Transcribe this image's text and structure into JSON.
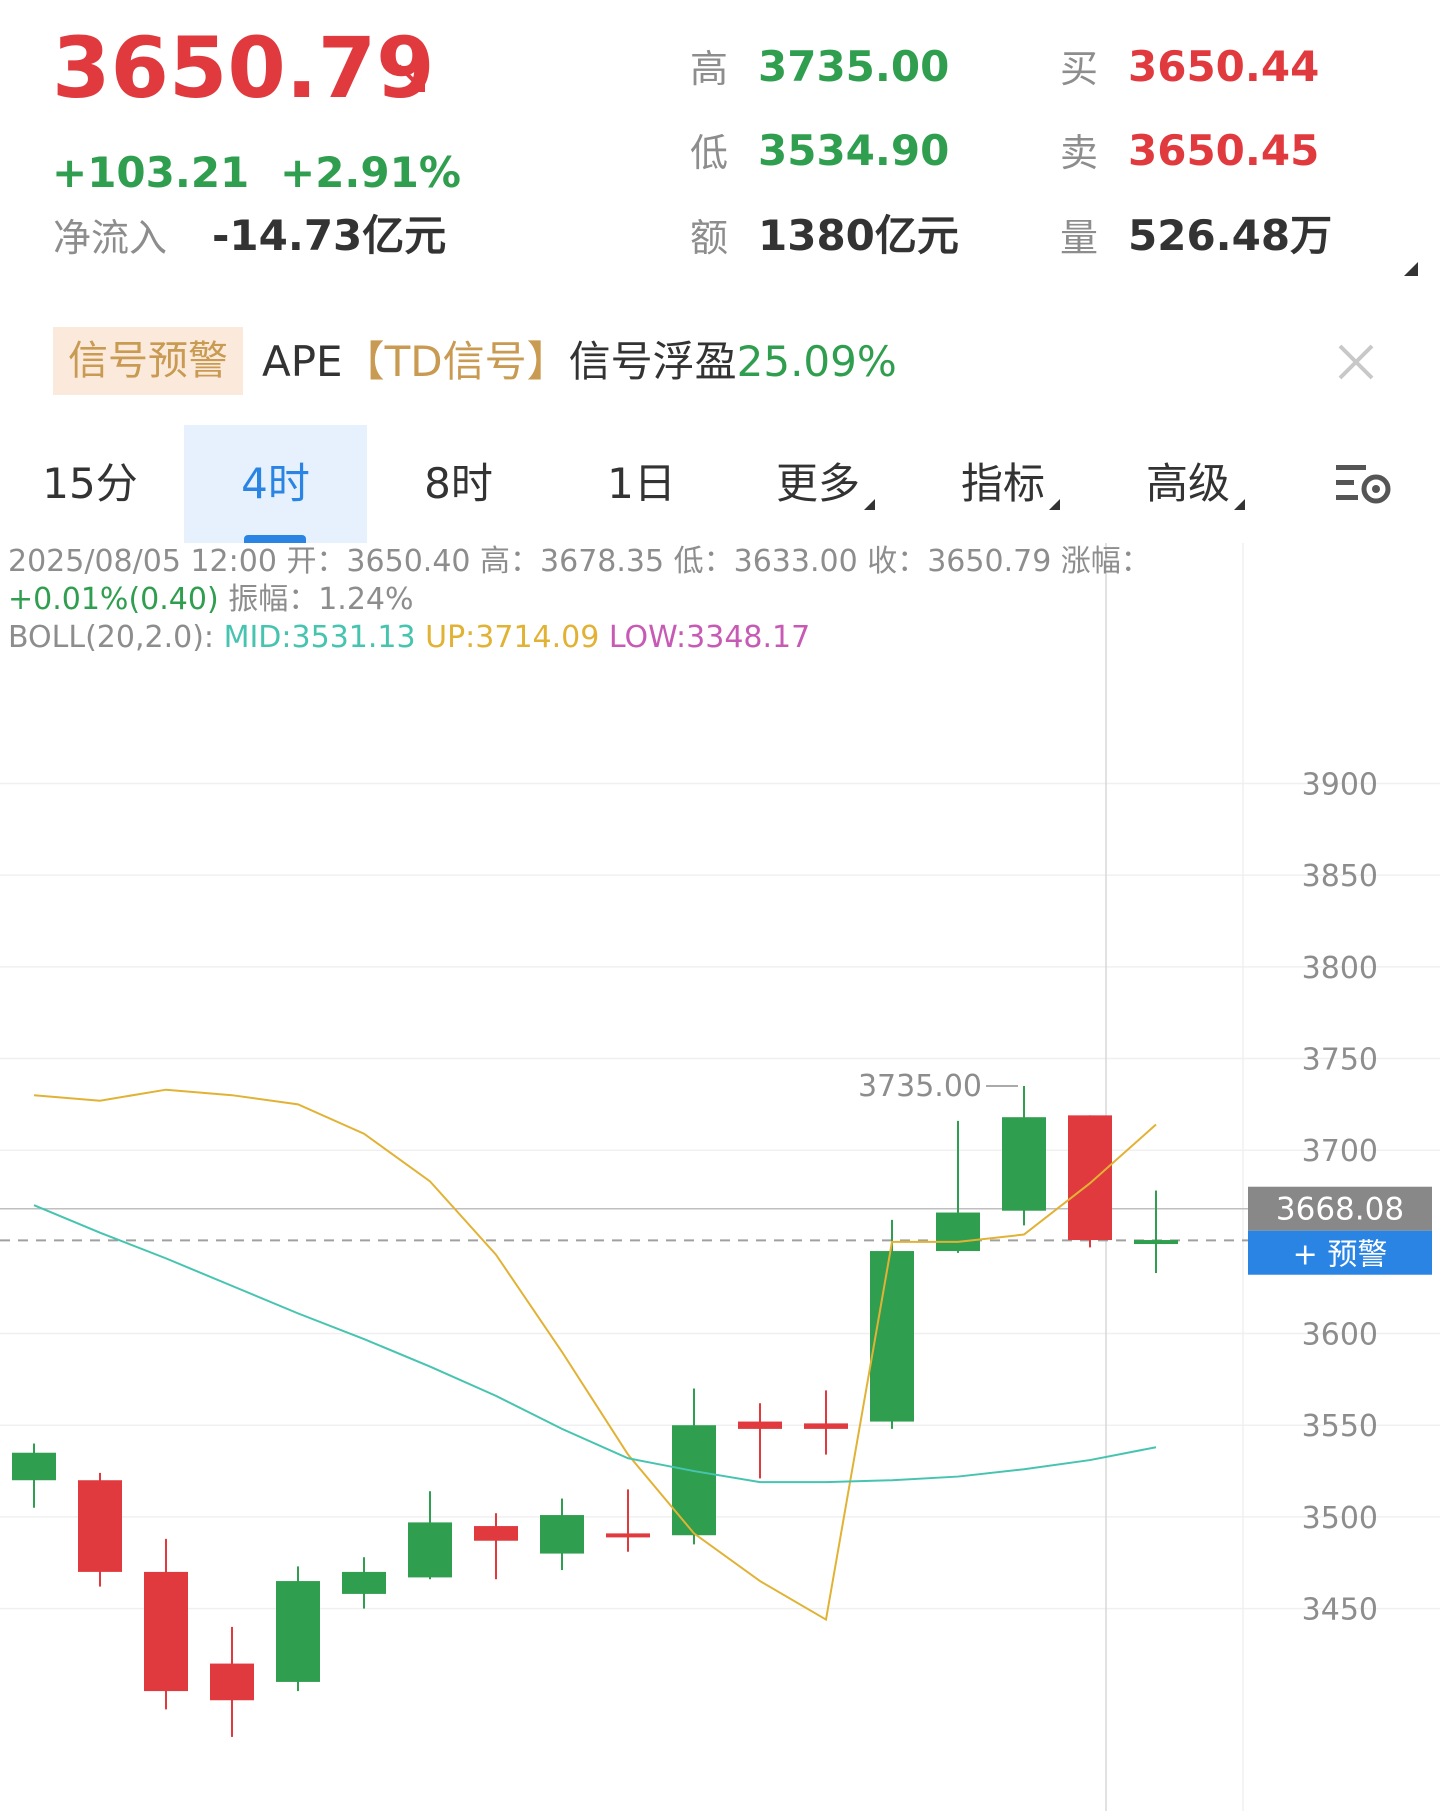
{
  "quote": {
    "price": "3650.79",
    "change_abs": "+103.21",
    "change_pct": "+2.91%",
    "net_inflow_label": "净流入",
    "net_inflow_value": "-14.73亿元",
    "high_label": "高",
    "high_value": "3735.00",
    "low_label": "低",
    "low_value": "3534.90",
    "amount_label": "额",
    "amount_value": "1380亿元",
    "bid_label": "买",
    "bid_value": "3650.44",
    "ask_label": "卖",
    "ask_value": "3650.45",
    "volume_label": "量",
    "volume_value": "526.48万"
  },
  "signal": {
    "badge": "信号预警",
    "prefix": "APE",
    "tag": "【TD信号】",
    "text": "信号浮盈",
    "value": "25.09%"
  },
  "tabs": [
    {
      "label": "15分"
    },
    {
      "label": "4时",
      "active": true
    },
    {
      "label": "8时"
    },
    {
      "label": "1日"
    },
    {
      "label": "更多"
    },
    {
      "label": "指标"
    },
    {
      "label": "高级"
    }
  ],
  "info": {
    "line1": "2025/08/05 12:00 开：3650.40 高：3678.35 低：3633.00 收：3650.79 涨幅：",
    "line2_change": "+0.01%(0.40)",
    "line2_rest": " 振幅：1.24%",
    "boll_label": "BOLL(20,2.0):",
    "boll_mid": "MID:3531.13",
    "boll_up": "UP:3714.09",
    "boll_low": "LOW:3348.17"
  },
  "colors": {
    "up": "#e0393e",
    "down": "#2f9e4f",
    "accent": "#2a84e4",
    "boll_up": "#e1b234",
    "boll_mid": "#46c4b0",
    "boll_low": "#c75ab5"
  },
  "chart_data": {
    "type": "candlestick",
    "y_ticks": [
      3900,
      3850,
      3800,
      3750,
      3700,
      3600,
      3550,
      3500,
      3450
    ],
    "ylim": [
      3410,
      3970
    ],
    "high_marker": "3735.00",
    "crosshair_price": "3668.08",
    "alert_button": "+ 预警",
    "last_price": 3650.79,
    "candles": [
      {
        "open": 3520,
        "close": 3535,
        "high": 3540,
        "low": 3505
      },
      {
        "open": 3520,
        "close": 3470,
        "high": 3524,
        "low": 3462
      },
      {
        "open": 3470,
        "close": 3405,
        "high": 3488,
        "low": 3395
      },
      {
        "open": 3420,
        "close": 3400,
        "high": 3440,
        "low": 3380
      },
      {
        "open": 3410,
        "close": 3465,
        "high": 3473,
        "low": 3405
      },
      {
        "open": 3458,
        "close": 3470,
        "high": 3478,
        "low": 3450
      },
      {
        "open": 3467,
        "close": 3497,
        "high": 3514,
        "low": 3466
      },
      {
        "open": 3495,
        "close": 3487,
        "high": 3502,
        "low": 3466
      },
      {
        "open": 3480,
        "close": 3501,
        "high": 3510,
        "low": 3471
      },
      {
        "open": 3491,
        "close": 3490,
        "high": 3515,
        "low": 3481
      },
      {
        "open": 3490,
        "close": 3550,
        "high": 3570,
        "low": 3485
      },
      {
        "open": 3552,
        "close": 3548,
        "high": 3562,
        "low": 3521
      },
      {
        "open": 3551,
        "close": 3548,
        "high": 3569,
        "low": 3534
      },
      {
        "open": 3552,
        "close": 3645,
        "high": 3662,
        "low": 3548
      },
      {
        "open": 3645,
        "close": 3666,
        "high": 3716,
        "low": 3644
      },
      {
        "open": 3667,
        "close": 3718,
        "high": 3735,
        "low": 3659
      },
      {
        "open": 3719,
        "close": 3651,
        "high": 3719,
        "low": 3647
      },
      {
        "open": 3650,
        "close": 3651,
        "high": 3678,
        "low": 3633
      }
    ],
    "boll_up": [
      3730,
      3727,
      3733,
      3730,
      3725,
      3709,
      3683,
      3643,
      3590,
      3534,
      3491,
      3465,
      3444,
      3650,
      3650,
      3654,
      3682,
      3714
    ],
    "boll_mid": [
      3670,
      3655,
      3641,
      3626,
      3611,
      3597,
      3582,
      3566,
      3548,
      3532,
      3525,
      3519,
      3519,
      3520,
      3522,
      3526,
      3531,
      3538
    ]
  }
}
